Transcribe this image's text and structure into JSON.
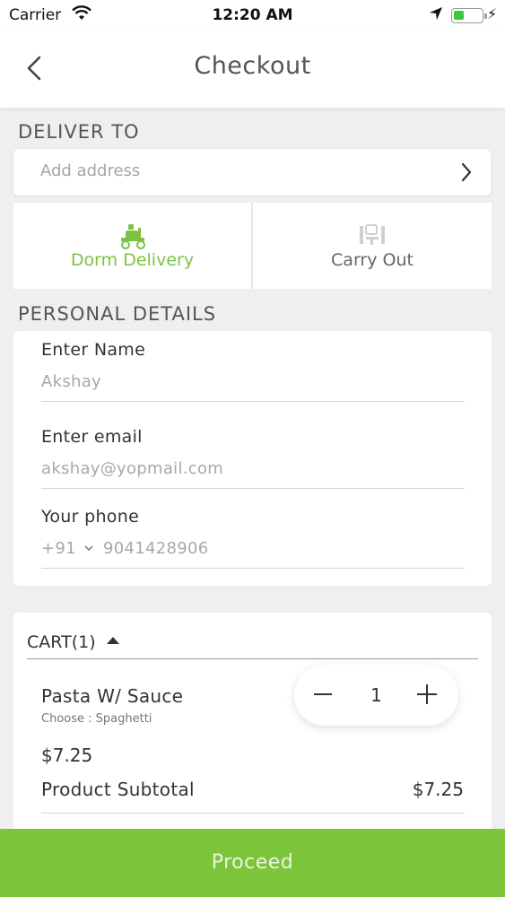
{
  "status_bar": {
    "carrier": "Carrier",
    "time": "12:20 AM"
  },
  "nav": {
    "title": "Checkout",
    "back_icon": "chevron-left-icon"
  },
  "deliver_to": {
    "header": "DELIVER TO",
    "address_placeholder": "Add address"
  },
  "delivery_modes": [
    {
      "label": "Dorm Delivery",
      "icon": "scooter-icon",
      "selected": true,
      "color": "#7cc242"
    },
    {
      "label": "Carry Out",
      "icon": "carry-out-icon",
      "selected": false,
      "color": "#666666"
    }
  ],
  "personal_details": {
    "header": "PERSONAL DETAILS",
    "name_label": "Enter Name",
    "name_value": "Akshay",
    "email_label": "Enter email",
    "email_value": "akshay@yopmail.com",
    "phone_label": "Your phone",
    "country_code": "+91",
    "phone_value": "9041428906"
  },
  "cart": {
    "title": "CART(1)",
    "item": {
      "name": "Pasta W/ Sauce",
      "option": "Choose : Spaghetti",
      "price": "$7.25",
      "quantity": "1"
    },
    "subtotal_label": "Product Subtotal",
    "subtotal_value": "$7.25"
  },
  "proceed_label": "Proceed",
  "colors": {
    "accent": "#7cc53a",
    "background": "#efeff2"
  }
}
